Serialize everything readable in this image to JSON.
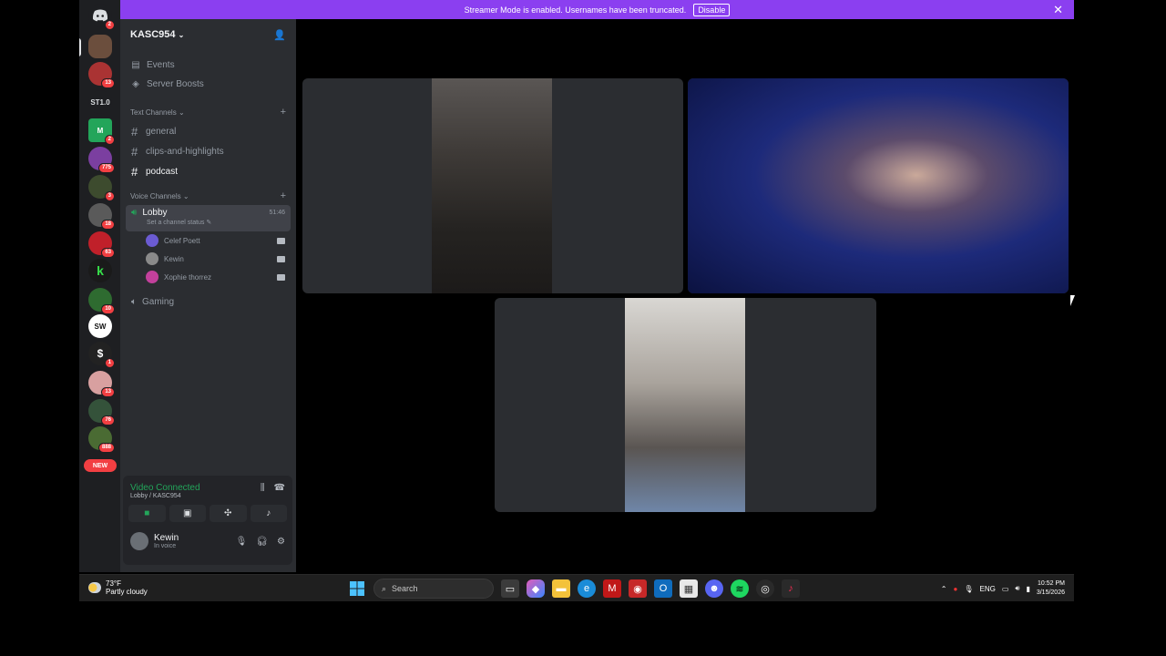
{
  "banner": {
    "text": "Streamer Mode is enabled. Usernames have been truncated.",
    "disable_label": "Disable"
  },
  "rail": {
    "servers": [
      {
        "label": "",
        "badge": "2",
        "color": "#5865f2"
      },
      {
        "label": "",
        "badge": "",
        "color": "#6b4e3d"
      },
      {
        "label": "",
        "badge": "13",
        "color": "#a33"
      },
      {
        "label": "ST1.0",
        "badge": "",
        "color": "#1e1f22"
      },
      {
        "label": "M",
        "badge": "2",
        "color": "#23a55a"
      },
      {
        "label": "",
        "badge": "775",
        "color": "#7b3fa0"
      },
      {
        "label": "",
        "badge": "3",
        "color": "#3d4b2e"
      },
      {
        "label": "",
        "badge": "18",
        "color": "#5a5a5a"
      },
      {
        "label": "",
        "badge": "63",
        "color": "#c0202a"
      },
      {
        "label": "k",
        "badge": "",
        "color": "#1a1a1a"
      },
      {
        "label": "",
        "badge": "10",
        "color": "#2e6b30"
      },
      {
        "label": "SW",
        "badge": "",
        "color": "#ffffff"
      },
      {
        "label": "$",
        "badge": "1",
        "color": "#222"
      },
      {
        "label": "",
        "badge": "13",
        "color": "#d8a0a0"
      },
      {
        "label": "",
        "badge": "76",
        "color": "#34523a"
      },
      {
        "label": "",
        "badge": "888",
        "color": "#4a6b33"
      }
    ],
    "new_label": "NEW"
  },
  "sidebar": {
    "server_name": "KASC954",
    "events_label": "Events",
    "boosts_label": "Server Boosts",
    "text_category": "Text Channels",
    "text_channels": [
      "general",
      "clips-and-highlights",
      "podcast"
    ],
    "voice_category": "Voice Channels",
    "lobby": {
      "name": "Lobby",
      "timer": "51:46",
      "status": "Set a channel status"
    },
    "voice_users": [
      {
        "name": "Celef Poett",
        "color": "#6b5bd2"
      },
      {
        "name": "Kewin",
        "color": "#8a8a8a"
      },
      {
        "name": "Xophie thorrez",
        "color": "#c2409b"
      }
    ],
    "gaming_label": "Gaming"
  },
  "panel": {
    "status": "Video Connected",
    "location": "Lobby / KASC954",
    "user_name": "Kewin",
    "user_status": "In voice"
  },
  "taskbar": {
    "temp": "73°F",
    "weather": "Partly cloudy",
    "search_placeholder": "Search",
    "lang": "ENG",
    "time": "10:52 PM",
    "date": "3/15/2026"
  }
}
